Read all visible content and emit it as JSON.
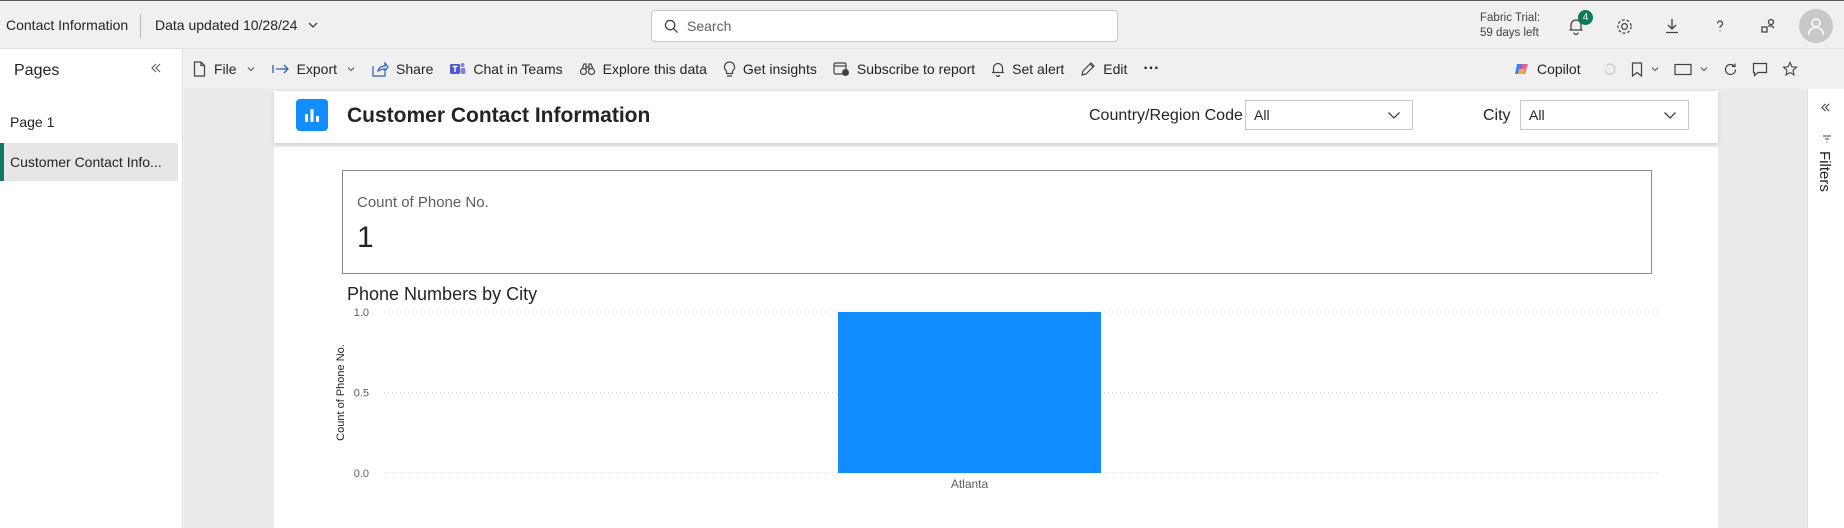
{
  "header": {
    "app_title": "Contact Information",
    "data_updated": "Data updated 10/28/24",
    "search_placeholder": "Search",
    "trial_line1": "Fabric Trial:",
    "trial_line2": "59 days left",
    "notification_count": "4"
  },
  "pages_pane": {
    "title": "Pages",
    "items": [
      {
        "label": "Page 1",
        "active": false
      },
      {
        "label": "Customer Contact Info...",
        "active": true
      }
    ]
  },
  "toolbar": {
    "file": "File",
    "export": "Export",
    "share": "Share",
    "chat_in_teams": "Chat in Teams",
    "explore": "Explore this data",
    "insights": "Get insights",
    "subscribe": "Subscribe to report",
    "set_alert": "Set alert",
    "edit": "Edit",
    "more": "···",
    "copilot": "Copilot"
  },
  "report": {
    "title": "Customer Contact Information",
    "slicers": [
      {
        "label": "Country/Region Code",
        "value": "All"
      },
      {
        "label": "City",
        "value": "All"
      }
    ],
    "card": {
      "label": "Count of Phone No.",
      "value": "1"
    },
    "chart_title": "Phone Numbers by City"
  },
  "filters_pane": {
    "label": "Filters"
  },
  "colors": {
    "accent": "#118dff",
    "page_active": "#117865",
    "badge": "#0e7a5a"
  },
  "chart_data": {
    "type": "bar",
    "title": "Phone Numbers by City",
    "categories": [
      "Atlanta"
    ],
    "values": [
      1
    ],
    "xlabel": "",
    "ylabel": "Count of Phone No.",
    "ylim": [
      0,
      1
    ],
    "yticks": [
      "0.0",
      "0.5",
      "1.0"
    ],
    "grid": true,
    "bar_color": "#118dff"
  }
}
